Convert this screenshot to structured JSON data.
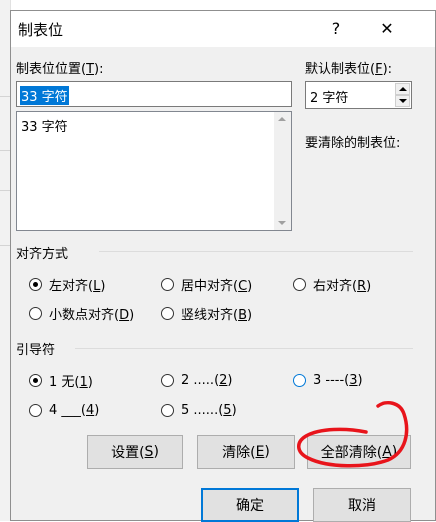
{
  "dialog": {
    "title": "制表位",
    "help": "?",
    "close": "✕"
  },
  "tab_position": {
    "label": "制表位位置(",
    "hotkey": "T",
    "label_end": "):",
    "value": "33 字符",
    "list_items": [
      "33 字符"
    ]
  },
  "default_tab": {
    "label": "默认制表位(",
    "hotkey": "F",
    "label_end": "):",
    "value": "2 字符"
  },
  "to_clear": {
    "label": "要清除的制表位:"
  },
  "alignment": {
    "title": "对齐方式",
    "options": [
      {
        "text": "左对齐(",
        "key": "L",
        "end": ")",
        "selected": true
      },
      {
        "text": "居中对齐(",
        "key": "C",
        "end": ")",
        "selected": false
      },
      {
        "text": "右对齐(",
        "key": "R",
        "end": ")",
        "selected": false
      },
      {
        "text": "小数点对齐(",
        "key": "D",
        "end": ")",
        "selected": false
      },
      {
        "text": "竖线对齐(",
        "key": "B",
        "end": ")",
        "selected": false
      }
    ]
  },
  "leader": {
    "title": "引导符",
    "options": [
      {
        "text": "1 无(",
        "key": "1",
        "end": ")",
        "selected": true
      },
      {
        "text": "2 .....(",
        "key": "2",
        "end": ")",
        "selected": false
      },
      {
        "text": "3 ----(",
        "key": "3",
        "end": ")",
        "selected": false
      },
      {
        "text": "4 ___(",
        "key": "4",
        "end": ")",
        "selected": false
      },
      {
        "text": "5 ......(",
        "key": "5",
        "end": ")",
        "selected": false
      }
    ]
  },
  "buttons": {
    "set": {
      "text": "设置(",
      "key": "S",
      "end": ")"
    },
    "clear": {
      "text": "清除(",
      "key": "E",
      "end": ")"
    },
    "clear_all": {
      "text": "全部清除(",
      "key": "A",
      "end": ")"
    },
    "ok": "确定",
    "cancel": "取消"
  },
  "colors": {
    "accent": "#0078d7",
    "annotation": "#e8141b"
  }
}
